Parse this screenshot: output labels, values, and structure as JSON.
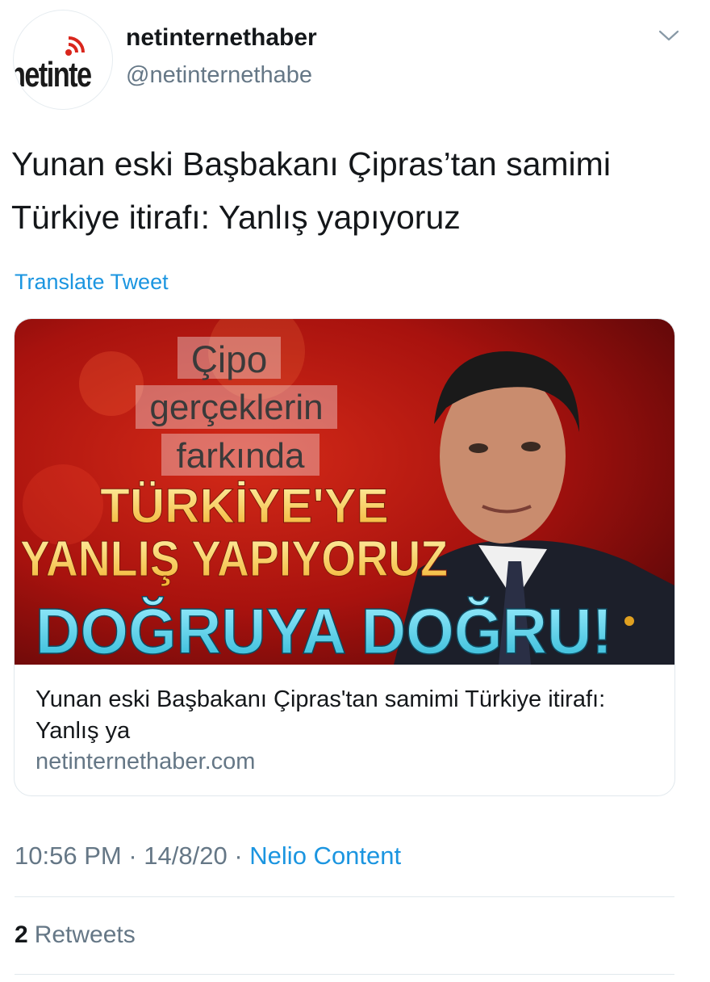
{
  "author": {
    "name": "netinternethaber",
    "handle": "@netinternethabe",
    "avatar_logo_text": "netinte"
  },
  "tweet": {
    "text": "Yunan eski Başbakanı Çipras’tan samimi Türkiye itirafı: Yanlış yapıyoruz",
    "translate_label": "Translate Tweet"
  },
  "card": {
    "image": {
      "line1": "Çipo",
      "line2": "gerçeklerin",
      "line3": "farkında",
      "headline1": "TÜRKİYE'YE",
      "headline2": "YANLIŞ YAPIYORUZ",
      "banner": "DOĞRUYA DOĞRU!"
    },
    "title": "Yunan eski Başbakanı Çipras'tan samimi Türkiye itirafı: Yanlış ya",
    "domain": "netinternethaber.com"
  },
  "meta": {
    "time": "10:56 PM",
    "separator": "·",
    "date": "14/8/20",
    "source": "Nelio Content"
  },
  "stats": {
    "retweets_count": "2",
    "retweets_label": "Retweets"
  },
  "colors": {
    "link": "#1b95e0",
    "muted": "#657786",
    "text": "#14171a",
    "border": "#e1e8ed",
    "image_red": "#b3140f",
    "banner_cyan": "#3ec6e0"
  },
  "icons": {
    "menu": "chevron-down-icon",
    "avatar_signal": "wifi-signal-icon"
  }
}
